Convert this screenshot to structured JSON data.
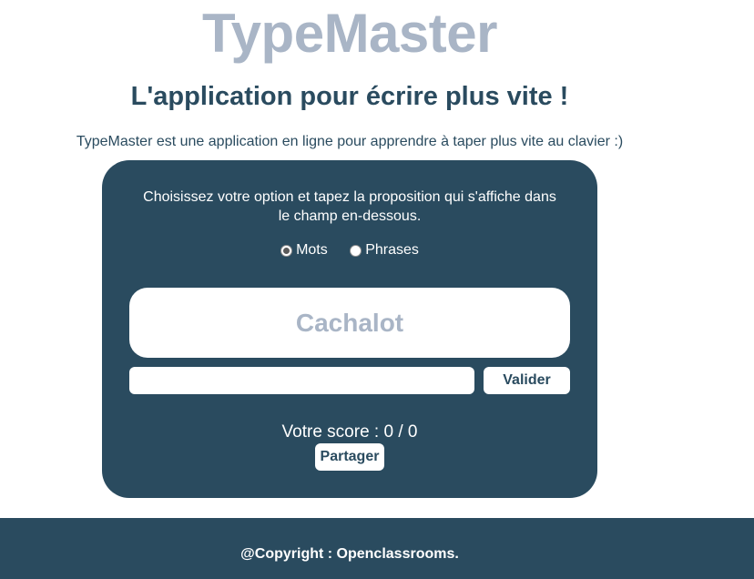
{
  "header": {
    "logo": "TypeMaster",
    "subtitle": "L'application pour écrire plus vite !",
    "intro": "TypeMaster est une application en ligne pour apprendre à taper plus vite au clavier :)"
  },
  "zone": {
    "instructions": "Choisissez votre option et tapez la proposition qui s'affiche dans le champ en-dessous.",
    "options": [
      {
        "label": "Mots",
        "checked": true
      },
      {
        "label": "Phrases",
        "checked": false
      }
    ],
    "proposition": "Cachalot",
    "input": {
      "value": "",
      "placeholder": ""
    },
    "validate_label": "Valider",
    "score_text": "Votre score : 0 / 0",
    "share_label": "Partager"
  },
  "footer": {
    "copyright": "@Copyright : Openclassrooms."
  },
  "colors": {
    "primary": "#2a4b5f",
    "logo": "#a9b5c6",
    "background": "#ffffff"
  }
}
